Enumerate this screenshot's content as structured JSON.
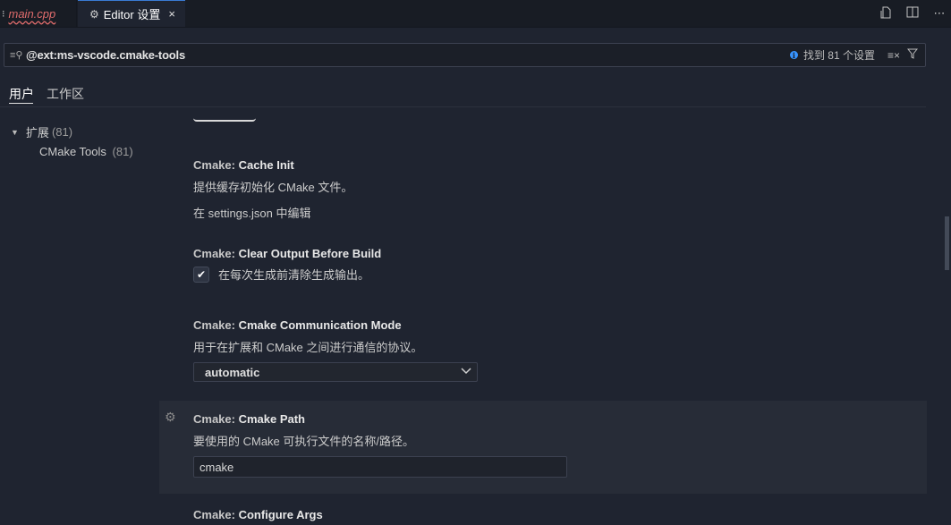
{
  "tabs": [
    {
      "label": "main.cpp",
      "prefix": "⁝"
    },
    {
      "label": "Editor 设置",
      "close": "×"
    }
  ],
  "toolbar": {
    "icons": [
      "open-settings-json-icon",
      "split-editor-icon",
      "more-actions-icon"
    ]
  },
  "search": {
    "query": "@ext:ms-vscode.cmake-tools",
    "result_count": "找到 81 个设置"
  },
  "scope_tabs": [
    "用户",
    "工作区"
  ],
  "toc": {
    "root": {
      "label": "扩展",
      "count": "(81)"
    },
    "child": {
      "label": "CMake Tools",
      "count": "(81)"
    }
  },
  "settings": [
    {
      "category": "Cmake: ",
      "name": "Cache Init",
      "description": "提供缓存初始化 CMake 文件。",
      "link": "在 settings.json 中编辑"
    },
    {
      "category": "Cmake: ",
      "name": "Clear Output Before Build",
      "checkbox_label": "在每次生成前清除生成输出。",
      "checked": true
    },
    {
      "category": "Cmake: ",
      "name": "Cmake Communication Mode",
      "description": "用于在扩展和 CMake 之间进行通信的协议。",
      "value": "automatic"
    },
    {
      "category": "Cmake: ",
      "name": "Cmake Path",
      "description": "要使用的 CMake 可执行文件的名称/路径。",
      "value": "cmake"
    },
    {
      "category": "Cmake: ",
      "name": "Configure Args"
    }
  ],
  "colors": {
    "background": "#1f2430",
    "accent": "#3794ff",
    "error": "#e06c6c"
  }
}
